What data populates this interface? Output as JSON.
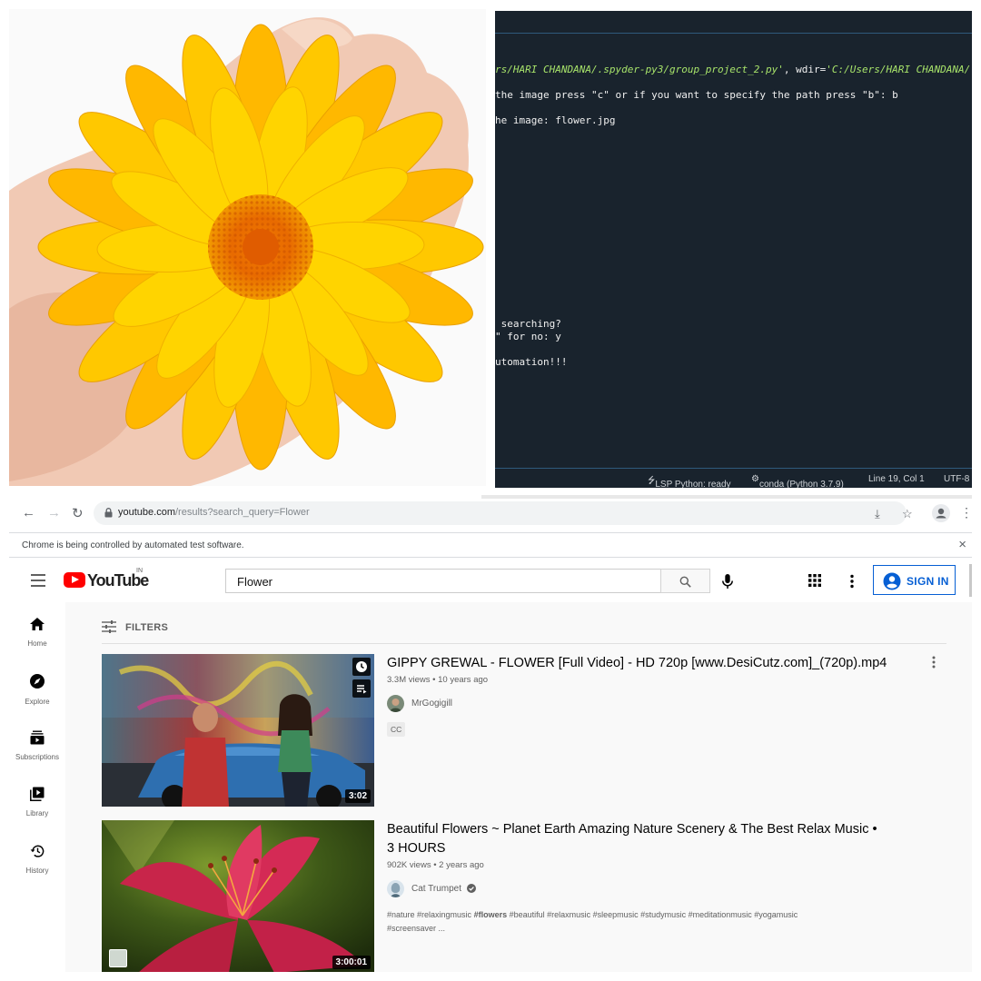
{
  "console": {
    "line1_prefix": "rs/HARI CHANDANA/.spyder-py3/group_project_2.py'",
    "line1_mid": ", wdir=",
    "line1_suffix": "'C:/Users/HARI CHANDANA/",
    "line2": "the image press \"c\" or if you want to specify the path press \"b\": b",
    "line3": "he image: flower.jpg",
    "line4": " searching?",
    "line5": "\" for no: y",
    "line6": "utomation!!!",
    "status": {
      "lsp": "LSP Python: ready",
      "conda": "conda (Python 3.7.9)",
      "position": "Line 19, Col 1",
      "encoding": "UTF-8"
    }
  },
  "browser": {
    "url_host": "youtube.com",
    "url_path": "/results?search_query=Flower",
    "infobar": "Chrome is being controlled by automated test software.",
    "close_glyph": "×"
  },
  "youtube": {
    "logo_text": "YouTube",
    "country": "IN",
    "search_value": "Flower",
    "sign_in": "SIGN IN",
    "guide": [
      {
        "label": "Home",
        "icon": "home-icon"
      },
      {
        "label": "Explore",
        "icon": "explore-icon"
      },
      {
        "label": "Subscriptions",
        "icon": "subscriptions-icon"
      },
      {
        "label": "Library",
        "icon": "library-icon"
      },
      {
        "label": "History",
        "icon": "history-icon"
      }
    ],
    "filters_label": "FILTERS",
    "videos": [
      {
        "title": "GIPPY GREWAL - FLOWER [Full Video] - HD 720p [www.DesiCutz.com]_(720p).mp4",
        "stats": "3.3M views • 10 years ago",
        "channel": "MrGogigill",
        "badge": "CC",
        "duration": "3:02"
      },
      {
        "title_line1": "Beautiful Flowers ~ Planet Earth Amazing Nature Scenery & The Best Relax Music •",
        "title_line2": "3 HOURS",
        "stats": "902K views • 2 years ago",
        "channel": "Cat Trumpet",
        "desc_a": "#nature #relaxingmusic ",
        "desc_bold": "#flowers",
        "desc_b": " #beautiful #relaxmusic #sleepmusic #studymusic #meditationmusic #yogamusic",
        "desc_line2": "#screensaver ...",
        "duration": "3:00:01"
      }
    ]
  },
  "colors": {
    "youtube_red": "#ff0000",
    "link_blue": "#065fd4",
    "console_bg": "#19232d",
    "console_green": "#a7e36a"
  }
}
